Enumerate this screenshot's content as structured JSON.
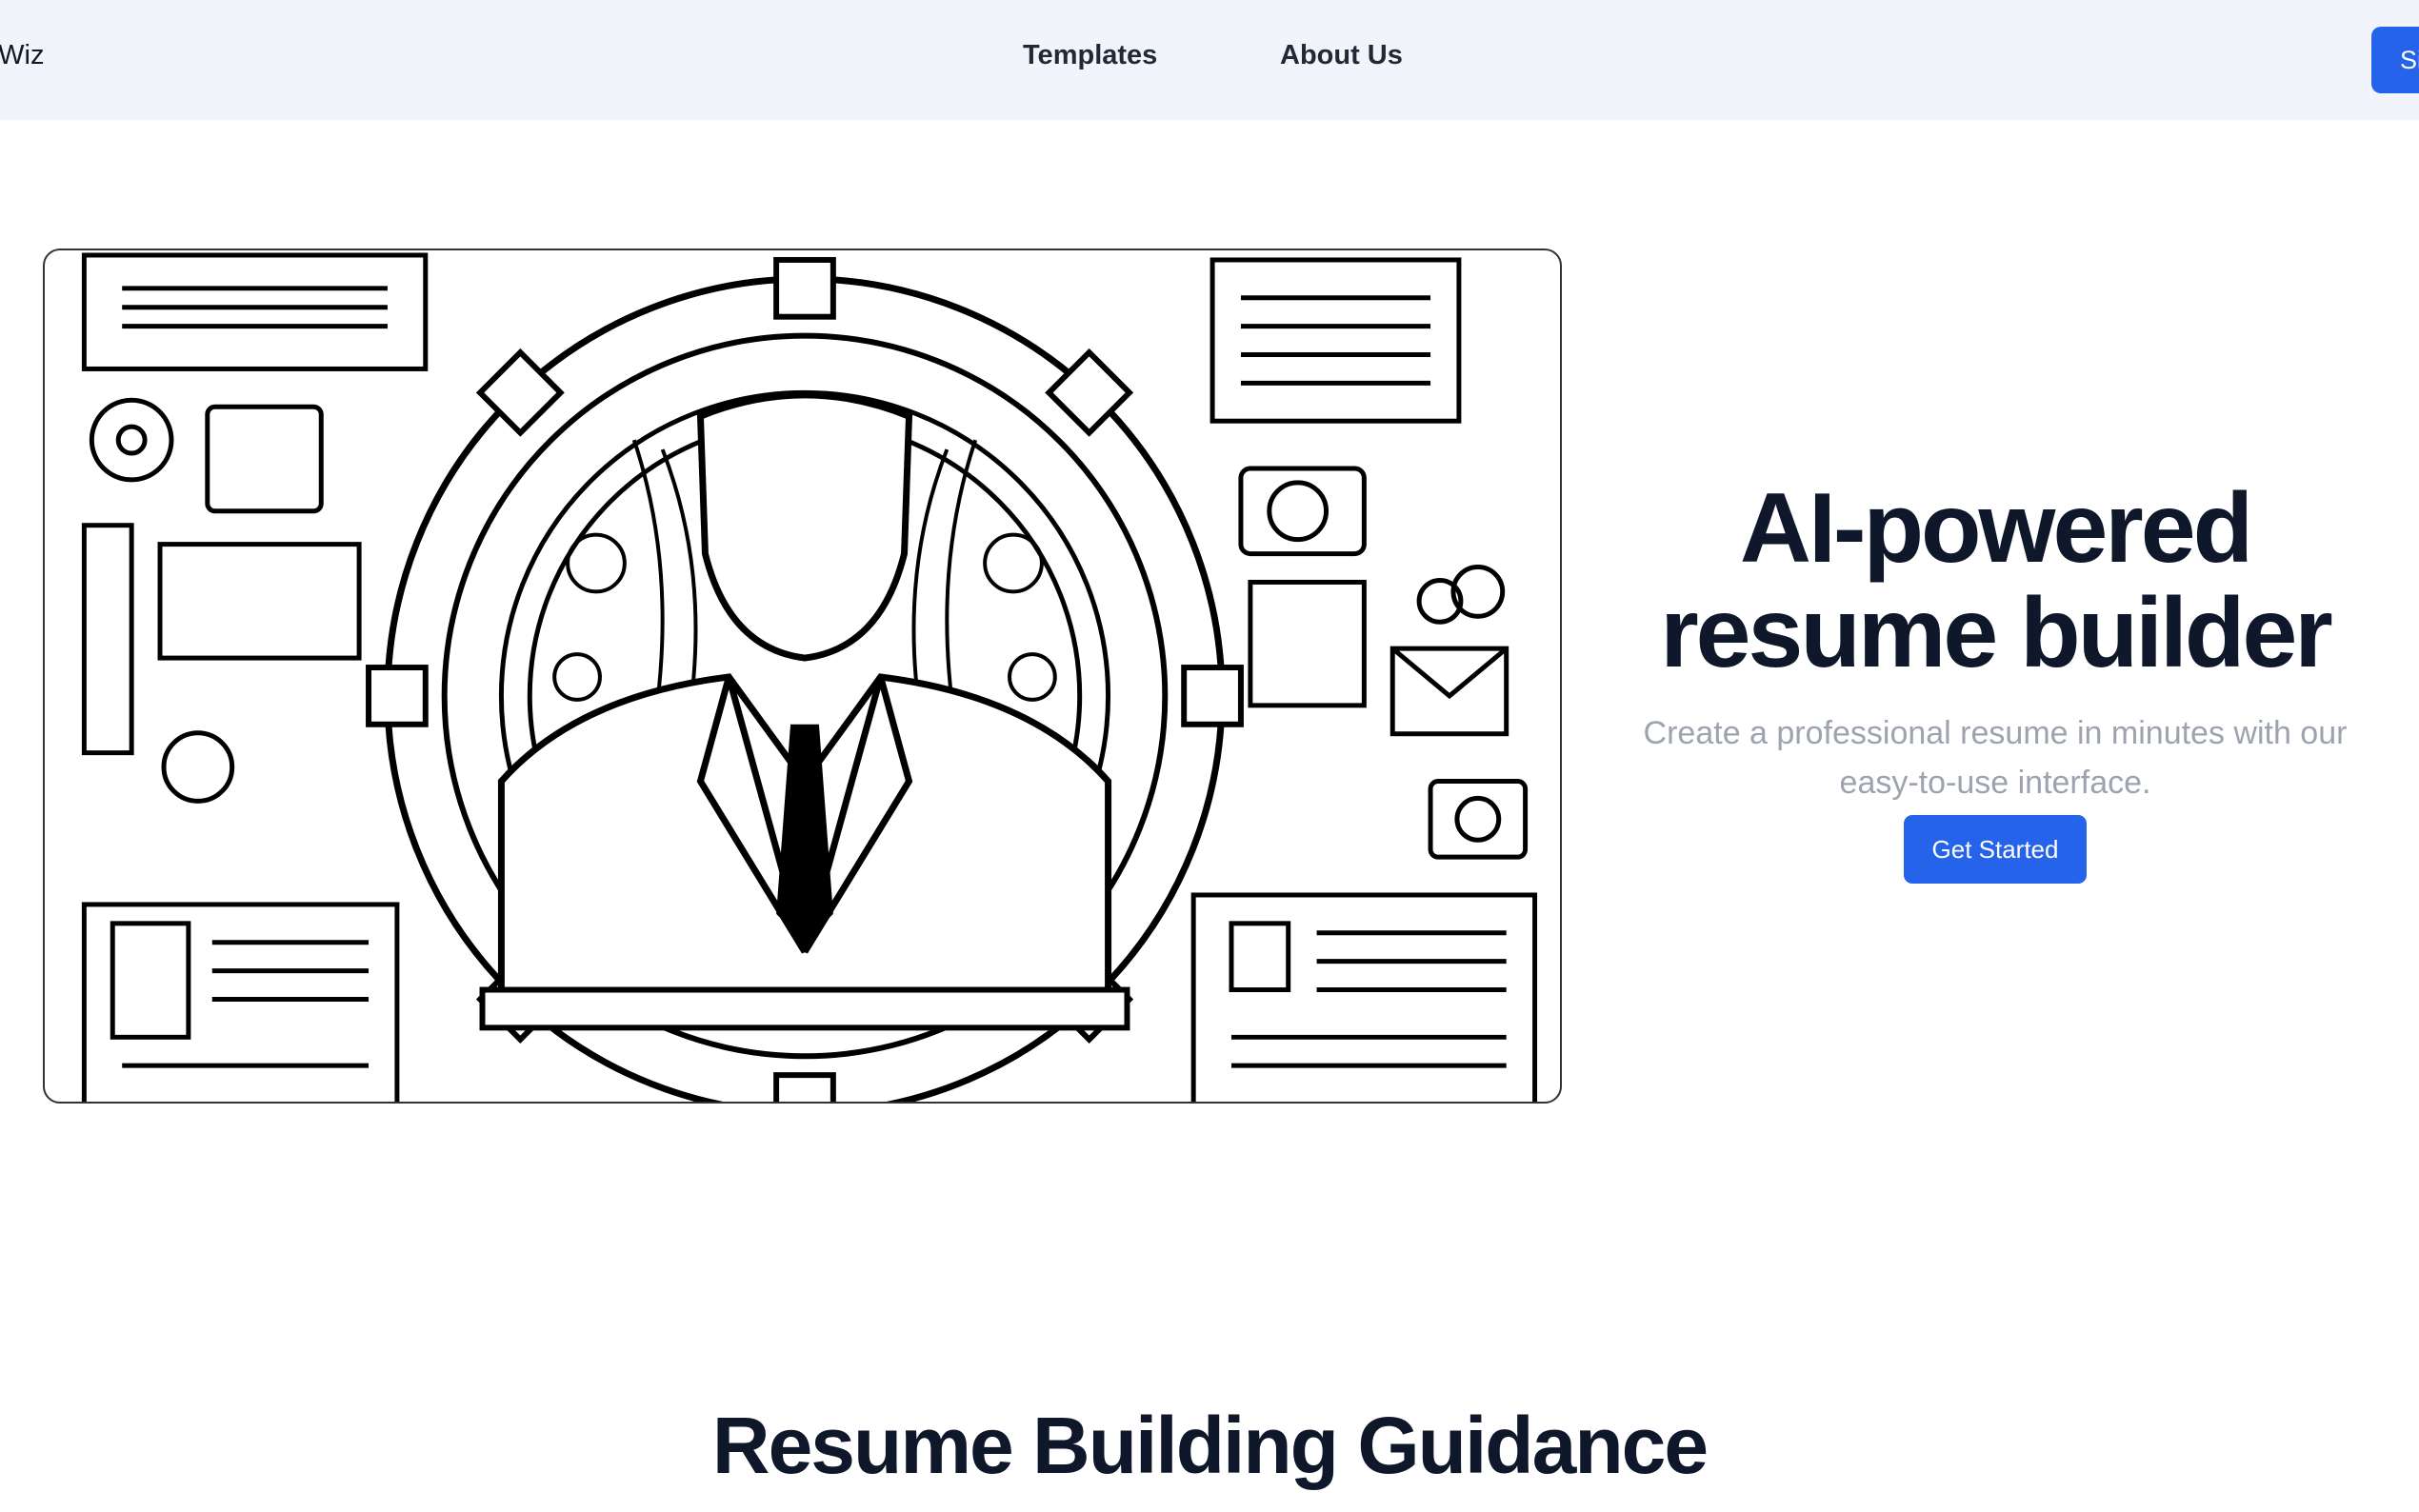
{
  "navbar": {
    "brand": "eWiz",
    "links": [
      {
        "label": "Templates"
      },
      {
        "label": "About Us"
      }
    ],
    "signin_label": "Si"
  },
  "hero": {
    "title_line1": "AI-powered",
    "title_line2": "resume builder",
    "subtitle": "Create a professional resume in minutes with our easy-to-use interface.",
    "cta_label": "Get Started",
    "image_icon": "robot-resume-illustration"
  },
  "section": {
    "title": "Resume Building Guidance"
  },
  "colors": {
    "accent": "#2563eb",
    "nav_bg": "#f1f5fb",
    "heading": "#0f172a",
    "muted": "#9ca3af"
  }
}
